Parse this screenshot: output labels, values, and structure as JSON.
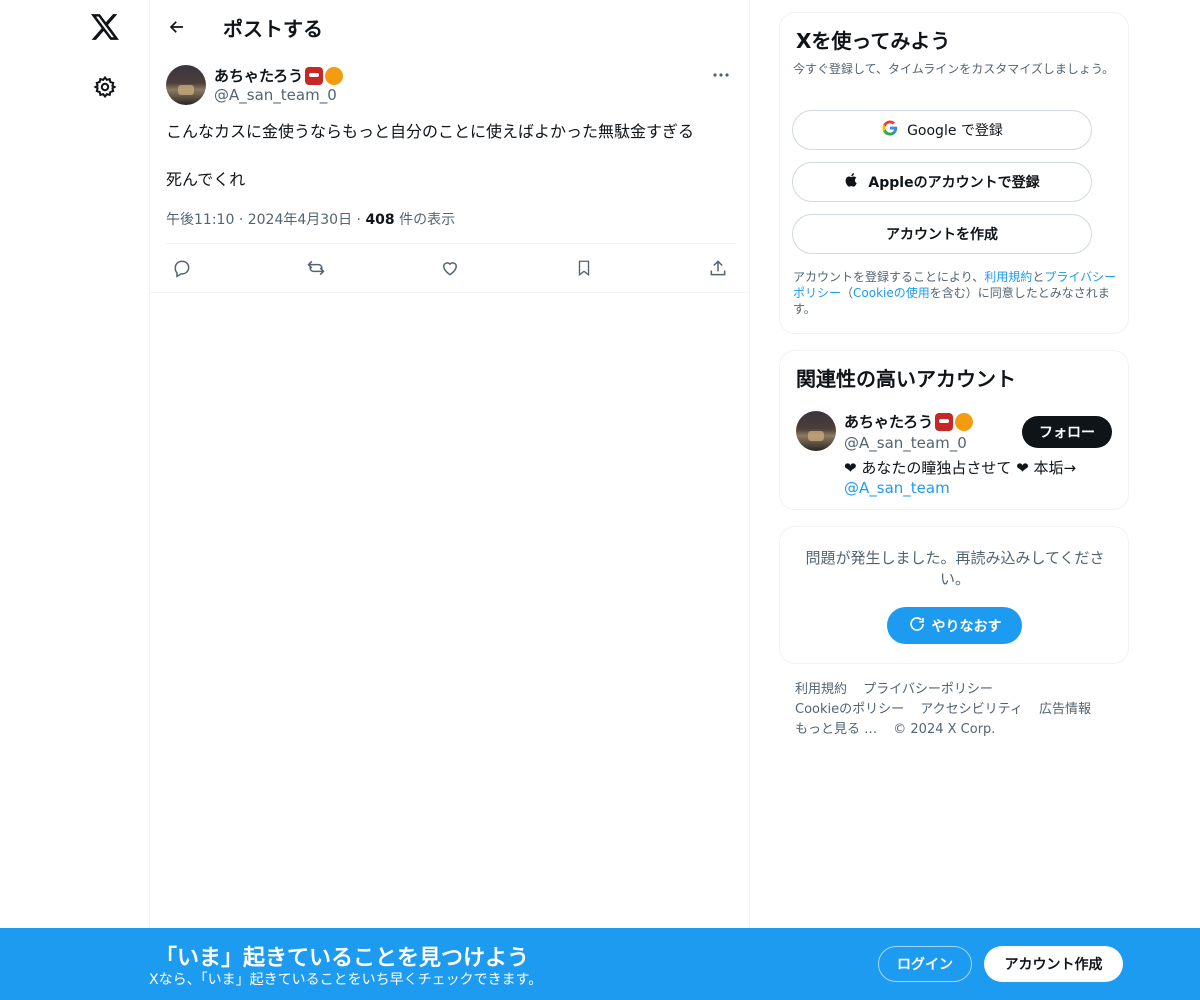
{
  "nav": {
    "logo_icon": "x-logo-icon",
    "settings_icon": "gear-icon"
  },
  "header": {
    "back_icon": "back-arrow-icon",
    "title": "ポストする"
  },
  "post": {
    "author_name": "あちゃたろう",
    "author_handle": "@A_san_team_0",
    "text_line1": "こんなカスに金使うならもっと自分のことに使えばよかった無駄金すぎる",
    "text_line2": "死んでくれ",
    "time": "午後11:10",
    "date": "2024年4月30日",
    "views_count": "408",
    "views_label": "件の表示",
    "separator": "·",
    "actions": [
      "reply-icon",
      "repost-icon",
      "like-icon",
      "bookmark-icon",
      "share-icon"
    ]
  },
  "signup_card": {
    "title": "Xを使ってみよう",
    "subtitle": "今すぐ登録して、タイムラインをカスタマイズしましょう。",
    "google_label": "Google で登録",
    "apple_label": "Appleのアカウントで登録",
    "create_label": "アカウントを作成",
    "terms_prefix": "アカウントを登録することにより、",
    "terms_link": "利用規約",
    "terms_and": "と",
    "privacy_link": "プライバシーポリシー",
    "cookie_open": "（",
    "cookie_link": "Cookieの使用",
    "terms_suffix": "を含む）に同意したとみなされます。"
  },
  "related": {
    "title": "関連性の高いアカウント",
    "name": "あちゃたろう",
    "handle": "@A_san_team_0",
    "follow_label": "フォロー",
    "bio_text": "❤ あなたの瞳独占させて ❤ 本垢→",
    "bio_link": "@A_san_team"
  },
  "error_card": {
    "message": "問題が発生しました。再読み込みしてください。",
    "retry_label": "やりなおす"
  },
  "footer": {
    "links": [
      "利用規約",
      "プライバシーポリシー",
      "Cookieのポリシー",
      "アクセシビリティ",
      "広告情報",
      "もっと見る …",
      "© 2024 X Corp."
    ]
  },
  "bottom_bar": {
    "title": "「いま」起きていることを見つけよう",
    "subtitle": "Xなら、「いま」起きていることをいち早くチェックできます。",
    "login_label": "ログイン",
    "signup_label": "アカウント作成"
  },
  "colors": {
    "accent": "#1d9bf0",
    "text": "#0f1419",
    "muted": "#536471",
    "border": "#eff3f4"
  }
}
